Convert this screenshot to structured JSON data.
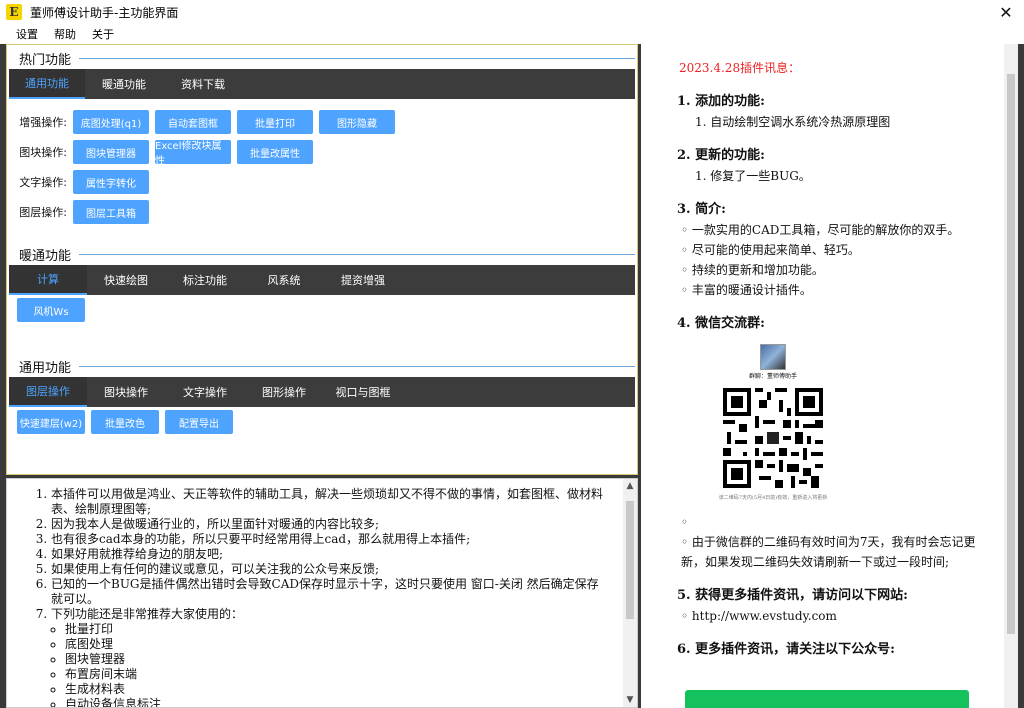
{
  "window": {
    "title": "董师傅设计助手-主功能界面",
    "icon_letter": "E"
  },
  "menu": [
    "设置",
    "帮助",
    "关于"
  ],
  "hot": {
    "title": "热门功能",
    "tabs": [
      "通用功能",
      "暖通功能",
      "资料下载"
    ],
    "rows": [
      {
        "label": "增强操作:",
        "buttons": [
          "底图处理(q1)",
          "自动套图框",
          "批量打印",
          "图形隐藏"
        ]
      },
      {
        "label": "图块操作:",
        "buttons": [
          "图块管理器",
          "Excel修改块属性",
          "批量改属性"
        ]
      },
      {
        "label": "文字操作:",
        "buttons": [
          "属性字转化"
        ]
      },
      {
        "label": "图层操作:",
        "buttons": [
          "图层工具箱"
        ]
      }
    ]
  },
  "hvac": {
    "title": "暖通功能",
    "tabs": [
      "计算",
      "快速绘图",
      "标注功能",
      "风系统",
      "提资增强"
    ],
    "buttons": [
      "风机Ws"
    ]
  },
  "general": {
    "title": "通用功能",
    "tabs": [
      "图层操作",
      "图块操作",
      "文字操作",
      "图形操作",
      "视口与图框"
    ],
    "buttons": [
      "快速建层(w2)",
      "批量改色",
      "配置导出"
    ]
  },
  "info": {
    "items": [
      "本插件可以用做是鸿业、天正等软件的辅助工具，解决一些烦琐却又不得不做的事情，如套图框、做材料表、绘制原理图等;",
      "因为我本人是做暖通行业的，所以里面针对暖通的内容比较多;",
      "也有很多cad本身的功能，所以只要平时经常用得上cad，那么就用得上本插件;",
      "如果好用就推荐给身边的朋友吧;",
      "如果使用上有任何的建议或意见，可以关注我的公众号来反馈;",
      "已知的一个BUG是插件偶然出错时会导致CAD保存时显示十字，这时只要使用 窗口-关闭 然后确定保存就可以。",
      "下列功能还是非常推荐大家使用的："
    ],
    "recommended": [
      "批量打印",
      "底图处理",
      "图块管理器",
      "布置房间末端",
      "生成材料表",
      "自动设备信息标注"
    ]
  },
  "news": {
    "heading": "2023.4.28插件讯息：",
    "sections": [
      {
        "title": "添加的功能:",
        "numbered": [
          "自动绘制空调水系统冷热源原理图"
        ]
      },
      {
        "title": "更新的功能:",
        "numbered": [
          "修复了一些BUG。"
        ]
      },
      {
        "title": "简介:",
        "bullets": [
          "一款实用的CAD工具箱，尽可能的解放你的双手。",
          "尽可能的使用起来简单、轻巧。",
          "持续的更新和增加功能。",
          "丰富的暖通设计插件。"
        ]
      },
      {
        "title": "微信交流群:",
        "bullets": [
          "",
          "由于微信群的二维码有效时间为7天，我有时会忘记更新，如果发现二维码失效请刷新一下或过一段时间;"
        ]
      },
      {
        "title": "获得更多插件资讯，请访问以下网站:",
        "bullets": [
          "http://www.evstudy.com"
        ]
      },
      {
        "title": "更多插件资讯，请关注以下公众号:"
      }
    ],
    "qr_caption": "群聊：董师傅助手",
    "qr_footnote": "该二维码7天内(5月4日前)有效，重新进入将更新"
  },
  "colors": {
    "accent": "#4ea3ff",
    "tabbar": "#3c3c3c",
    "news_red": "#e22222"
  }
}
